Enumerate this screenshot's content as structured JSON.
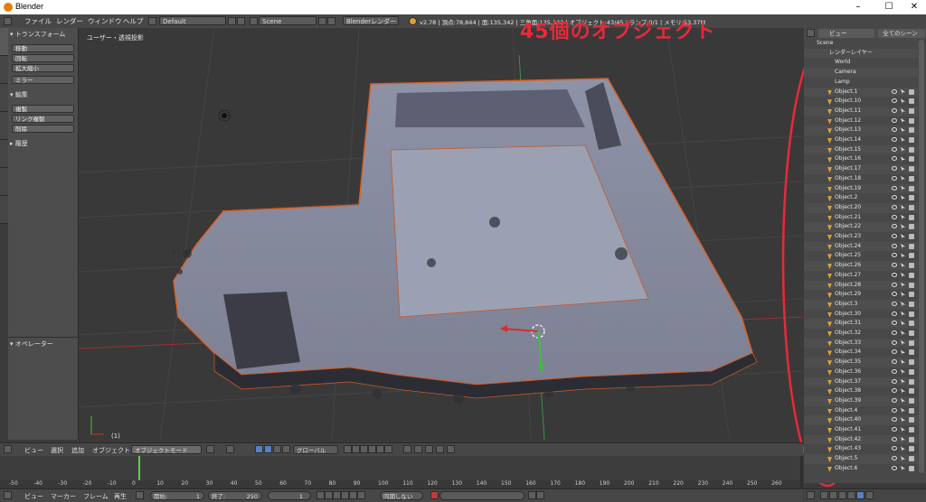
{
  "window": {
    "title": "Blender",
    "min": "–",
    "max": "☐",
    "close": "✕"
  },
  "menubar": {
    "items": [
      "ファイル",
      "レンダー",
      "ウィンドウ",
      "ヘルプ"
    ],
    "layout": "Default",
    "scene": "Scene",
    "engine": "Blenderレンダー",
    "stats": "v2.78 | 頂点:78,844 | 面:135,342 | 三角面:135,342 | オブジェクト:43/45 | ランプ:0/1 | メモリ:53.37M"
  },
  "tool_panel": {
    "transform_header": "▾ トランスフォーム",
    "transform_buttons": [
      "移動",
      "回転",
      "拡大縮小"
    ],
    "mirror": "ミラー",
    "edit_header": "▾ 編集",
    "edit_buttons": [
      "複製",
      "リンク複製",
      "削除"
    ],
    "history_header": "▸ 履歴",
    "operator_header": "▾ オペレーター"
  },
  "viewport": {
    "label": "ユーザー・透視投影",
    "frame_label": "(1)"
  },
  "annotation": {
    "text": "45個のオブジェクト",
    "color": "#e8293a"
  },
  "outliner": {
    "tab_view": "ビュー",
    "tab_all_scenes": "全てのシーン",
    "scene": "Scene",
    "render_layers": "レンダーレイヤー",
    "world": "World",
    "camera": "Camera",
    "lamp": "Lamp",
    "objects": [
      "Object.1",
      "Object.10",
      "Object.11",
      "Object.12",
      "Object.13",
      "Object.14",
      "Object.15",
      "Object.16",
      "Object.17",
      "Object.18",
      "Object.19",
      "Object.2",
      "Object.20",
      "Object.21",
      "Object.22",
      "Object.23",
      "Object.24",
      "Object.25",
      "Object.26",
      "Object.27",
      "Object.28",
      "Object.29",
      "Object.3",
      "Object.30",
      "Object.31",
      "Object.32",
      "Object.33",
      "Object.34",
      "Object.35",
      "Object.36",
      "Object.37",
      "Object.38",
      "Object.39",
      "Object.4",
      "Object.40",
      "Object.41",
      "Object.42",
      "Object.43",
      "Object.5",
      "Object.6"
    ]
  },
  "viewport_header": {
    "menus": [
      "ビュー",
      "選択",
      "追加",
      "オブジェクト"
    ],
    "mode": "オブジェクトモード",
    "orientation": "グローバル"
  },
  "timeline": {
    "ticks": [
      "-50",
      "-40",
      "-30",
      "-20",
      "-10",
      "0",
      "10",
      "20",
      "30",
      "40",
      "50",
      "60",
      "70",
      "80",
      "90",
      "100",
      "110",
      "120",
      "130",
      "140",
      "150",
      "160",
      "170",
      "180",
      "190",
      "200",
      "210",
      "220",
      "230",
      "240",
      "250",
      "260"
    ],
    "current_frame_color": "#5fcf3c"
  },
  "timeline_header": {
    "menus": [
      "ビュー",
      "マーカー",
      "フレーム",
      "再生"
    ],
    "start_label": "開始:",
    "start_value": "1",
    "end_label": "終了:",
    "end_value": "250",
    "current_value": "1",
    "sync": "同期しない"
  }
}
